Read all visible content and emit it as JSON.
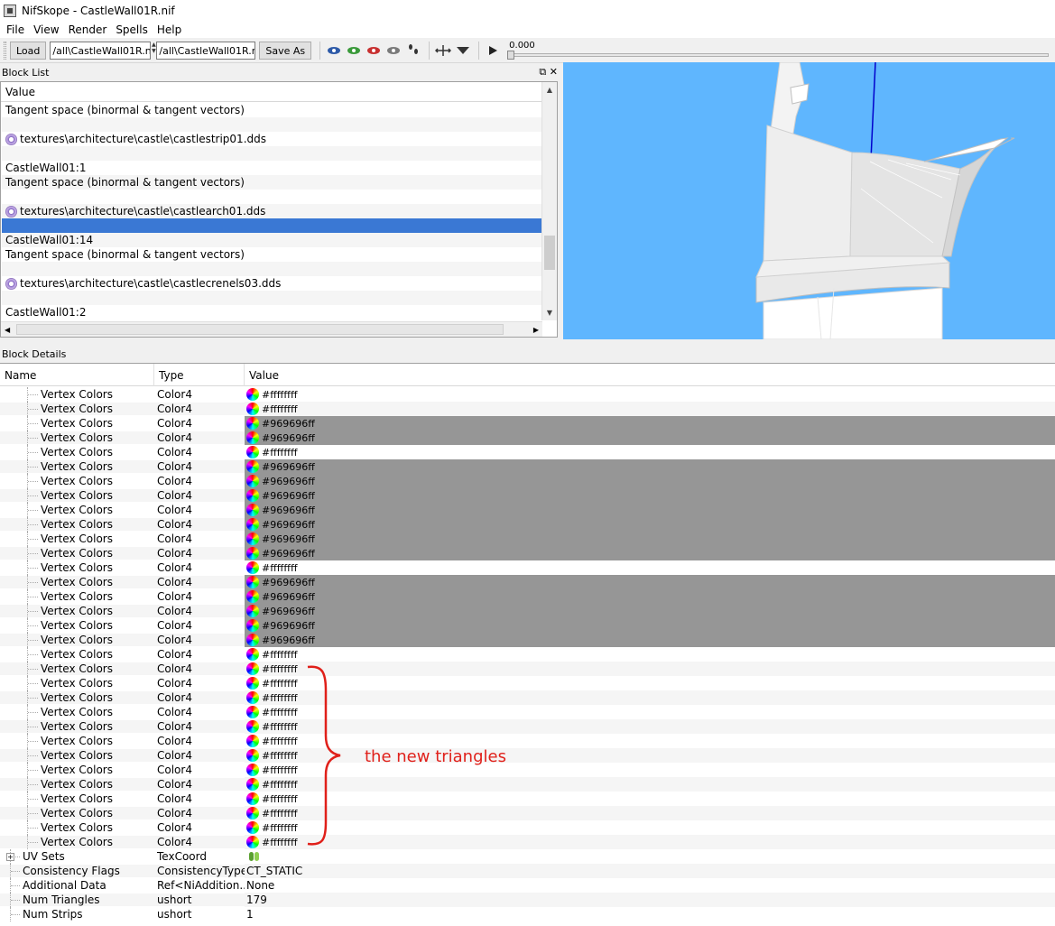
{
  "window": {
    "title": "NifSkope - CastleWall01R.nif"
  },
  "menu": [
    "File",
    "View",
    "Render",
    "Spells",
    "Help"
  ],
  "toolbar": {
    "load_label": "Load",
    "load_path": "/all\\CastleWall01R.nif",
    "save_path": "/all\\CastleWall01R.nif",
    "save_as_label": "Save As",
    "time_value": "0.000"
  },
  "block_list": {
    "title": "Block List",
    "column": "Value",
    "rows": [
      {
        "text": "Tangent space (binormal & tangent vectors)",
        "icon": ""
      },
      {
        "text": "",
        "icon": ""
      },
      {
        "text": "textures\\architecture\\castle\\castlestrip01.dds",
        "icon": "texture-icon"
      },
      {
        "text": "",
        "icon": ""
      },
      {
        "text": "CastleWall01:1",
        "icon": ""
      },
      {
        "text": "Tangent space (binormal & tangent vectors)",
        "icon": ""
      },
      {
        "text": "",
        "icon": ""
      },
      {
        "text": "textures\\architecture\\castle\\castlearch01.dds",
        "icon": "texture-icon"
      },
      {
        "text": "",
        "icon": "",
        "selected": true
      },
      {
        "text": "CastleWall01:14",
        "icon": ""
      },
      {
        "text": "Tangent space (binormal & tangent vectors)",
        "icon": ""
      },
      {
        "text": "",
        "icon": ""
      },
      {
        "text": "textures\\architecture\\castle\\castlecrenels03.dds",
        "icon": "texture-icon"
      },
      {
        "text": "",
        "icon": ""
      },
      {
        "text": "CastleWall01:2",
        "icon": ""
      }
    ]
  },
  "block_details": {
    "title": "Block Details",
    "columns": {
      "name": "Name",
      "type": "Type",
      "value": "Value"
    },
    "vertex_rows": [
      "#ffffffff",
      "#ffffffff",
      "#969696ff",
      "#969696ff",
      "#ffffffff",
      "#969696ff",
      "#969696ff",
      "#969696ff",
      "#969696ff",
      "#969696ff",
      "#969696ff",
      "#969696ff",
      "#ffffffff",
      "#969696ff",
      "#969696ff",
      "#969696ff",
      "#969696ff",
      "#969696ff",
      "#ffffffff",
      "#ffffffff",
      "#ffffffff",
      "#ffffffff",
      "#ffffffff",
      "#ffffffff",
      "#ffffffff",
      "#ffffffff",
      "#ffffffff",
      "#ffffffff",
      "#ffffffff",
      "#ffffffff",
      "#ffffffff",
      "#ffffffff"
    ],
    "vertex_name": "Vertex Colors",
    "vertex_type": "Color4",
    "extra_rows": [
      {
        "name": "UV Sets",
        "type": "TexCoord",
        "value": "",
        "icon": "uv-sets-icon",
        "expandable": true
      },
      {
        "name": "Consistency Flags",
        "type": "ConsistencyType",
        "value": "CT_STATIC"
      },
      {
        "name": "Additional Data",
        "type": "Ref<NiAddition...",
        "value": "None"
      },
      {
        "name": "Num Triangles",
        "type": "ushort",
        "value": "179"
      },
      {
        "name": "Num Strips",
        "type": "ushort",
        "value": "1"
      }
    ]
  },
  "annotation": {
    "text": "the new triangles",
    "color": "#e0201a"
  },
  "colors": {
    "selection": "#3a78d4",
    "viewport_bg": "#5fb6fe",
    "gray_row": "#969696"
  }
}
